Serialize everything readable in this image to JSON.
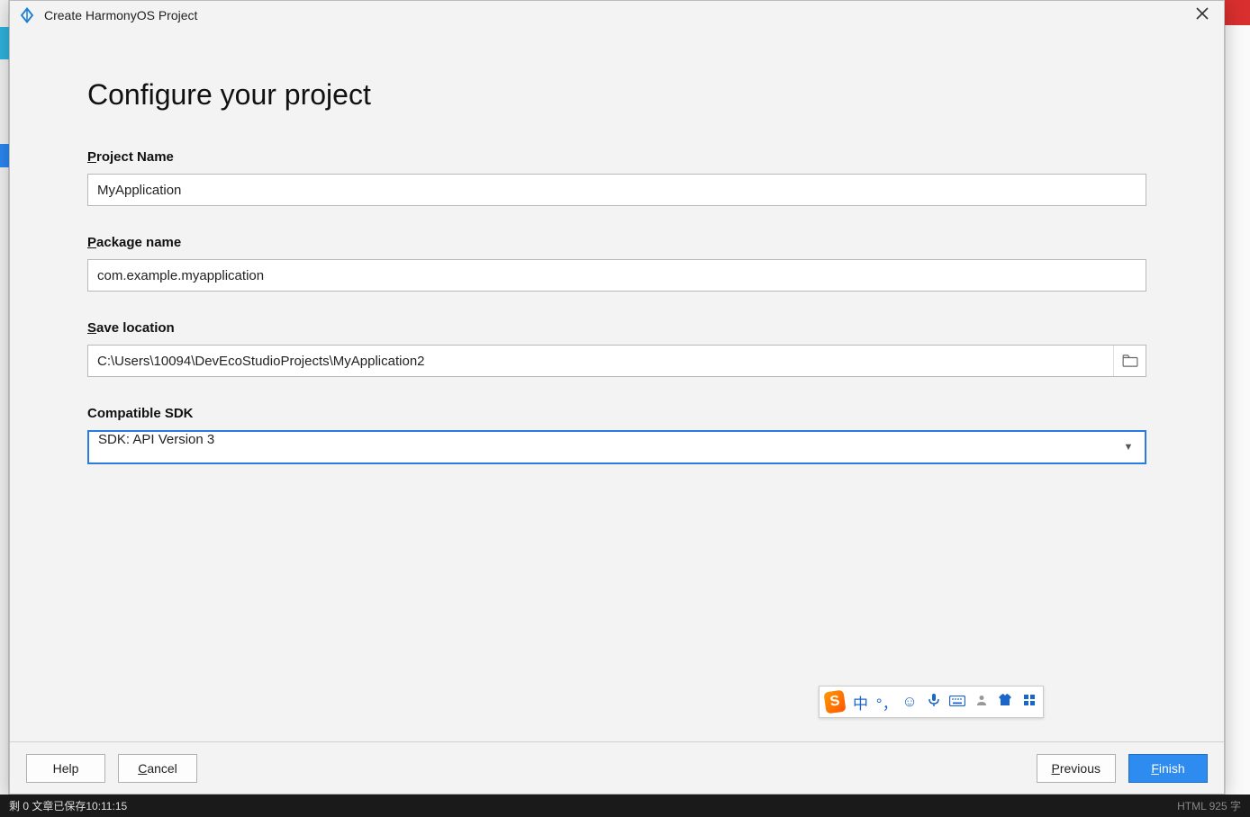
{
  "window": {
    "title": "Create HarmonyOS Project"
  },
  "heading": "Configure your project",
  "fields": {
    "projectName": {
      "label": "roject Name",
      "mnemonic": "P",
      "value": "MyApplication"
    },
    "packageName": {
      "label": "ackage name",
      "mnemonic": "P",
      "value": "com.example.myapplication"
    },
    "saveLocation": {
      "label": "ave location",
      "mnemonic": "S",
      "value": "C:\\Users\\10094\\DevEcoStudioProjects\\MyApplication2"
    },
    "compatibleSdk": {
      "label": "Compatible SDK",
      "value": "SDK: API Version 3"
    }
  },
  "buttons": {
    "help": "Help",
    "cancel": "ancel",
    "cancel_mn": "C",
    "previous": "revious",
    "previous_mn": "P",
    "finish": "inish",
    "finish_mn": "F"
  },
  "ime": {
    "logo": "S",
    "lang": "中"
  },
  "taskbar": {
    "left": "剩 0   文章已保存10:11:15",
    "right": "HTML   925 字"
  }
}
